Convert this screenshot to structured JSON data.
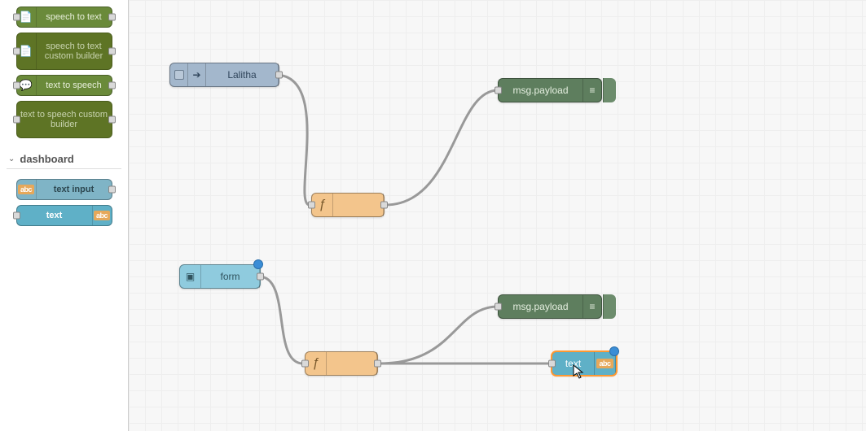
{
  "palette": {
    "speech_to_text": "speech to text",
    "stt_custom": "speech to text custom builder",
    "tts": "text to speech",
    "tts_custom": "text to speech custom builder",
    "category_dashboard": "dashboard",
    "text_input": "text input",
    "text": "text",
    "abc": "abc"
  },
  "canvas": {
    "inject_label": "Lalitha",
    "debug1_label": "msg.payload",
    "form_label": "form",
    "debug2_label": "msg.payload",
    "text_label": "text",
    "abc": "abc"
  },
  "icons": {
    "inject": "➔",
    "func": "ƒ",
    "debug_bars": "≡",
    "form_box": "▣",
    "speech": "💬"
  }
}
